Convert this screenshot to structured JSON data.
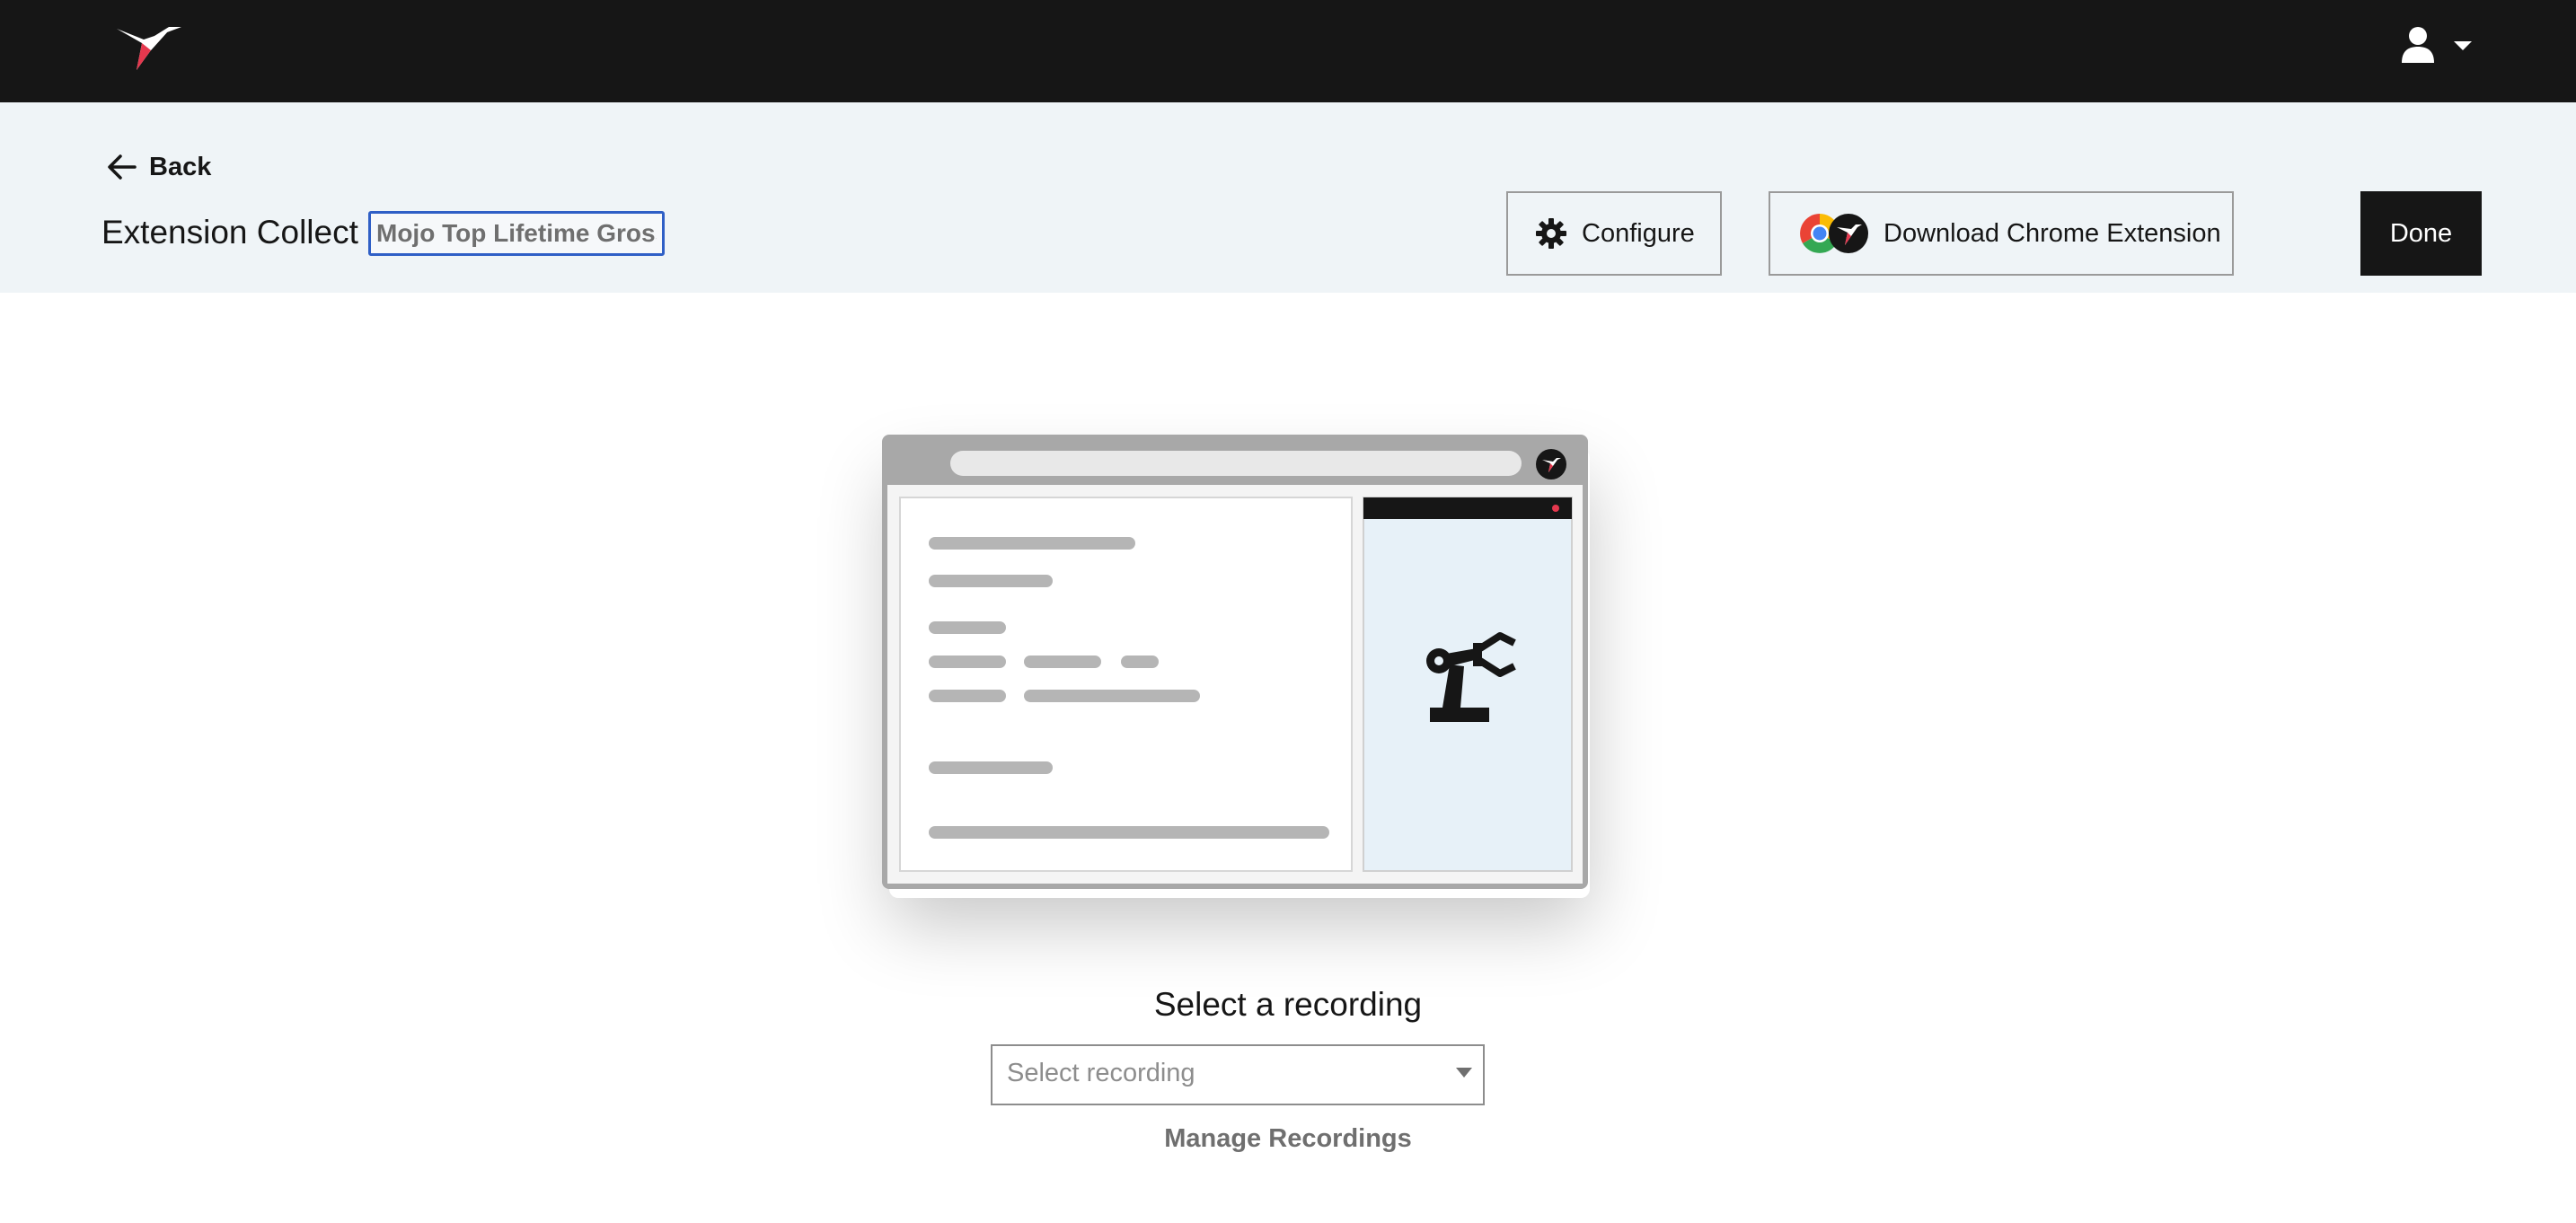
{
  "nav": {
    "logo_icon": "hummingbird-logo-icon",
    "user_icon": "user-icon",
    "user_caret_icon": "caret-down-icon"
  },
  "header": {
    "back_label": "Back",
    "title": "Extension Collect",
    "name_value": "Mojo Top Lifetime Grosse",
    "configure_label": "Configure",
    "download_label": "Download Chrome Extension",
    "done_label": "Done"
  },
  "main": {
    "select_heading": "Select a recording",
    "select_placeholder": "Select recording",
    "manage_label": "Manage Recordings"
  },
  "colors": {
    "nav_bg": "#161616",
    "header_bg": "#eff4f7",
    "focus_border": "#2f5fc6",
    "brand_red": "#e5384e"
  }
}
